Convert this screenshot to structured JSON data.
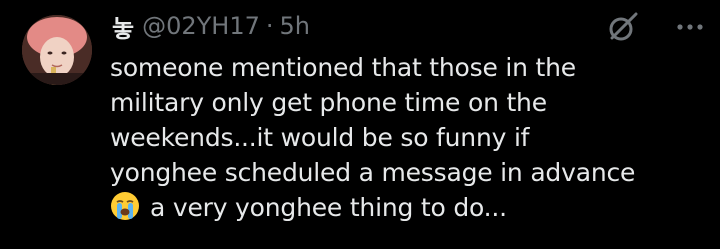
{
  "tweet": {
    "display_name": "놓",
    "handle": "@02YH17",
    "separator": "·",
    "time": "5h",
    "text_lines": [
      "someone mentioned that those in the",
      "military only get phone time on the",
      "weekends...it would be so funny if",
      "yonghee scheduled a message in advance",
      "a very yonghee thing to do..."
    ],
    "emoji": "loudly-crying-face-emoji",
    "icons": {
      "avatar": "profile-avatar",
      "grok": "grok-icon",
      "more": "more-options-icon"
    }
  }
}
